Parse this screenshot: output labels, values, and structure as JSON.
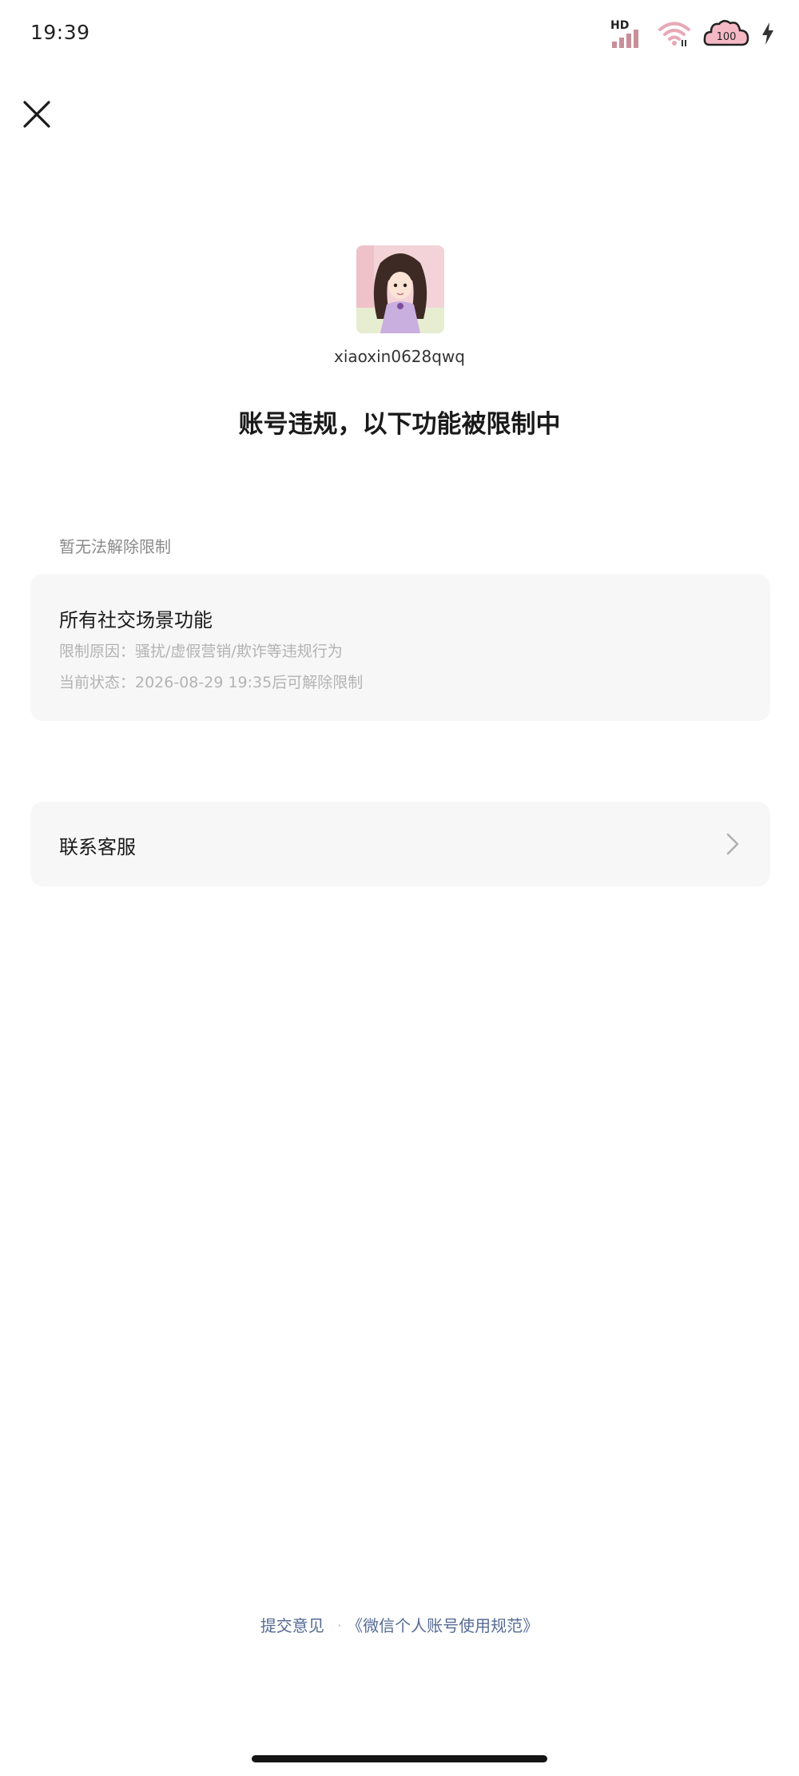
{
  "status_bar": {
    "time": "19:39",
    "network_label": "HD",
    "battery_level": "100",
    "icons": [
      "signal-icon",
      "wifi-icon",
      "battery-icon",
      "charging-icon"
    ]
  },
  "header": {
    "close_icon": "close-icon"
  },
  "profile": {
    "username": "xiaoxin0628qwq"
  },
  "headline": "账号违规，以下功能被限制中",
  "restriction_section": {
    "label": "暂无法解除限制",
    "card": {
      "title": "所有社交场景功能",
      "reason": "限制原因：骚扰/虚假营销/欺诈等违规行为",
      "state": "当前状态：2026-08-29 19:35后可解除限制"
    }
  },
  "service": {
    "label": "联系客服",
    "icon": "chevron-right-icon"
  },
  "footer": {
    "feedback_link": "提交意见",
    "separator": "·",
    "policy_link": "《微信个人账号使用规范》"
  },
  "colors": {
    "card_background": "#f7f7f7",
    "link": "#566b94",
    "muted_text": "#b3b3b3",
    "label_text": "#8a8a8a"
  }
}
